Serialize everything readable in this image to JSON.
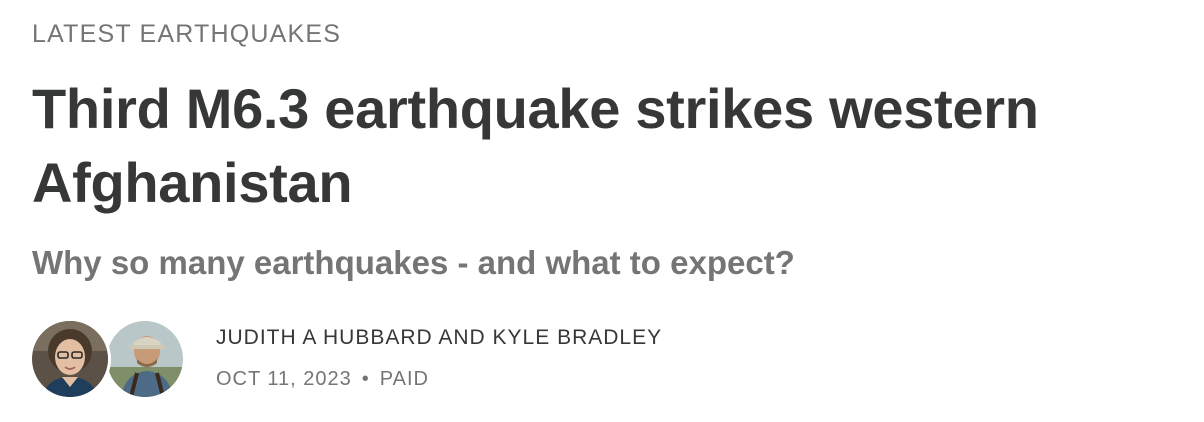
{
  "post": {
    "section": "LATEST EARTHQUAKES",
    "title": "Third M6.3 earthquake strikes western Afghanistan",
    "subtitle": "Why so many earthquakes - and what to expect?",
    "authors": "JUDITH A HUBBARD AND KYLE BRADLEY",
    "date": "OCT 11, 2023",
    "separator": "•",
    "access": "PAID"
  },
  "avatars": [
    {
      "icon": "avatar-judith-hubbard"
    },
    {
      "icon": "avatar-kyle-bradley"
    }
  ]
}
